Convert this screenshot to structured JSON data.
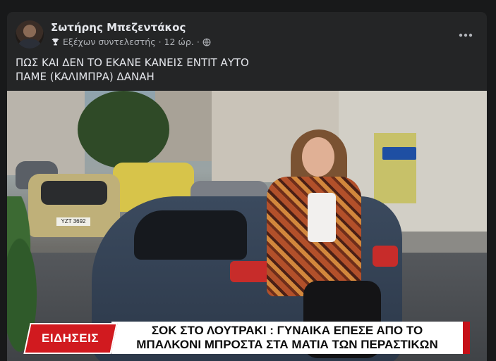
{
  "post": {
    "author": "Σωτήρης Μπεζεντάκος",
    "badge": "Εξέχων συντελεστής",
    "time": "12 ώρ.",
    "separator": "·",
    "caption_lines": [
      "ΠΩΣ ΚΑΙ ΔΕΝ ΤΟ ΕΚΑΝΕ ΚΑΝΕΙΣ ΕΝΤΙΤ ΑΥΤΟ",
      "ΠΑΜΕ (ΚΑΛΙΜΠΡΑ) ΔΑΝΑΗ"
    ]
  },
  "image": {
    "license_plate": "ΥΖΤ 3692",
    "news_logo": "ΕΙΔΗΣΕΙΣ",
    "headline_lines": [
      "ΣΟΚ ΣΤΟ ΛΟΥΤΡΑΚΙ : ΓΥΝΑΙΚΑ ΕΠΕΣΕ ΑΠΟ ΤΟ",
      "ΜΠΑΛΚΟΝΙ ΜΠΡΟΣΤΑ ΣΤΑ ΜΑΤΙΑ ΤΩΝ ΠΕΡΑΣΤΙΚΩΝ"
    ]
  },
  "icons": {
    "badge": "trophy-icon",
    "audience": "globe-icon",
    "menu": "more-options-icon"
  },
  "colors": {
    "page_bg": "#18191a",
    "card_bg": "#242526",
    "text_primary": "#e4e6eb",
    "text_secondary": "#b0b3b8",
    "news_red": "#d11a1f"
  }
}
